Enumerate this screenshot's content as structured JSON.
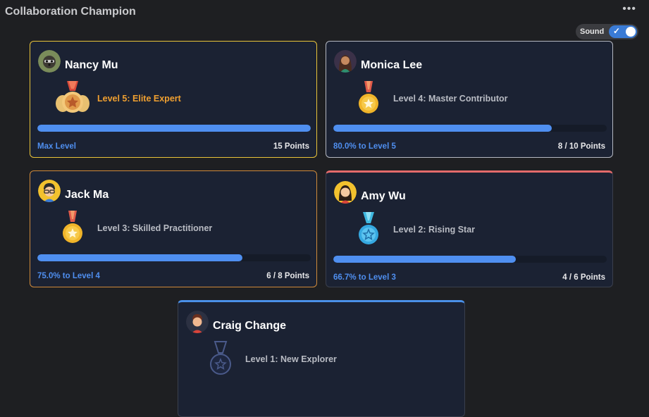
{
  "app": {
    "title": "Collaboration Champion",
    "more_icon": "more-horizontal-icon"
  },
  "sound": {
    "label": "Sound",
    "enabled": true
  },
  "cards": [
    {
      "name": "Nancy Mu",
      "level": "Level 5: Elite Expert",
      "progress_text": "Max Level",
      "points": "15 Points",
      "progress": 1.0,
      "border": "#e8c33a",
      "medal": "elite-medal-icon"
    },
    {
      "name": "Monica Lee",
      "level": "Level 4: Master Contributor",
      "progress_text": "80.0% to Level 5",
      "points": "8 / 10 Points",
      "progress": 0.8,
      "border": "#b5b8c2",
      "medal": "gold-medal-icon"
    },
    {
      "name": "Jack Ma",
      "level": "Level 3: Skilled Practitioner",
      "progress_text": "75.0% to Level 4",
      "points": "6 / 8 Points",
      "progress": 0.75,
      "border": "#cf8a3b",
      "medal": "gold-medal-icon"
    },
    {
      "name": "Amy Wu",
      "level": "Level 2: Rising Star",
      "progress_text": "66.7% to Level 3",
      "points": "4 / 6 Points",
      "progress": 0.667,
      "border": "#e46b6b",
      "medal": "blue-medal-icon"
    },
    {
      "name": "Craig Change",
      "level": "Level 1: New Explorer",
      "progress_text": "",
      "points": "",
      "progress": 0,
      "border": "#4a90e8",
      "medal": "dark-medal-icon"
    }
  ],
  "colors": {
    "background": "#1e1f22",
    "card": "#1b2233",
    "progress": "#4f8ff0",
    "elite_text": "#f0a030",
    "toggle": "#3a7bd5"
  }
}
